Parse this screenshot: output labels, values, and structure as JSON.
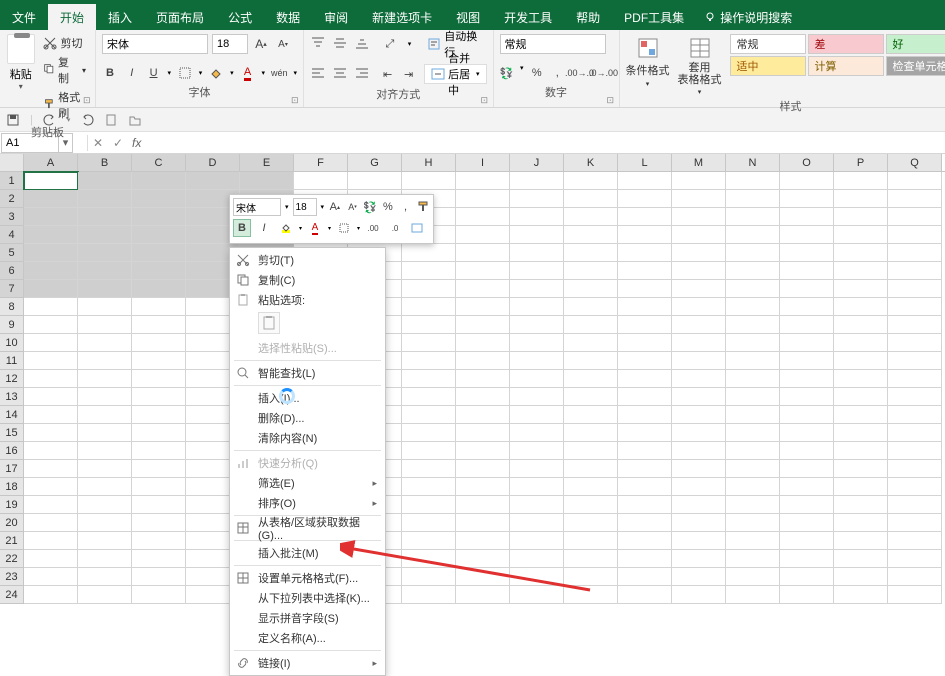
{
  "tabs": {
    "file": "文件",
    "home": "开始",
    "insert": "插入",
    "layout": "页面布局",
    "formulas": "公式",
    "data": "数据",
    "review": "审阅",
    "newtab": "新建选项卡",
    "view": "视图",
    "dev": "开发工具",
    "help": "帮助",
    "pdf": "PDF工具集",
    "tellme": "操作说明搜索"
  },
  "ribbon": {
    "clipboard": {
      "paste": "粘贴",
      "cut": "剪切",
      "copy": "复制",
      "painter": "格式刷",
      "group": "剪贴板"
    },
    "font": {
      "name": "宋体",
      "size": "18",
      "group": "字体"
    },
    "align": {
      "wrap": "自动换行",
      "merge": "合并后居中",
      "group": "对齐方式"
    },
    "number": {
      "format": "常规",
      "group": "数字"
    },
    "styles": {
      "cond": "条件格式",
      "table": "套用\n表格格式",
      "normal": "常规",
      "bad": "差",
      "good": "好",
      "neutral": "适中",
      "calc": "计算",
      "check": "检查单元格",
      "group": "样式"
    }
  },
  "namebox": "A1",
  "columns": [
    "A",
    "B",
    "C",
    "D",
    "E",
    "F",
    "G",
    "H",
    "I",
    "J",
    "K",
    "L",
    "M",
    "N",
    "O",
    "P",
    "Q"
  ],
  "rows_count": 24,
  "minitoolbar": {
    "font": "宋体",
    "size": "18"
  },
  "ctx": {
    "cut": "剪切(T)",
    "copy": "复制(C)",
    "paste_opts": "粘贴选项:",
    "paste_special": "选择性粘贴(S)...",
    "smart_lookup": "智能查找(L)",
    "insert": "插入(I)...",
    "delete": "删除(D)...",
    "clear": "清除内容(N)",
    "quick": "快速分析(Q)",
    "filter": "筛选(E)",
    "sort": "排序(O)",
    "fromtable": "从表格/区域获取数据(G)...",
    "comment": "插入批注(M)",
    "format": "设置单元格格式(F)...",
    "dropdown": "从下拉列表中选择(K)...",
    "phonetic": "显示拼音字段(S)",
    "define": "定义名称(A)...",
    "link": "链接(I)"
  },
  "chart_data": null
}
